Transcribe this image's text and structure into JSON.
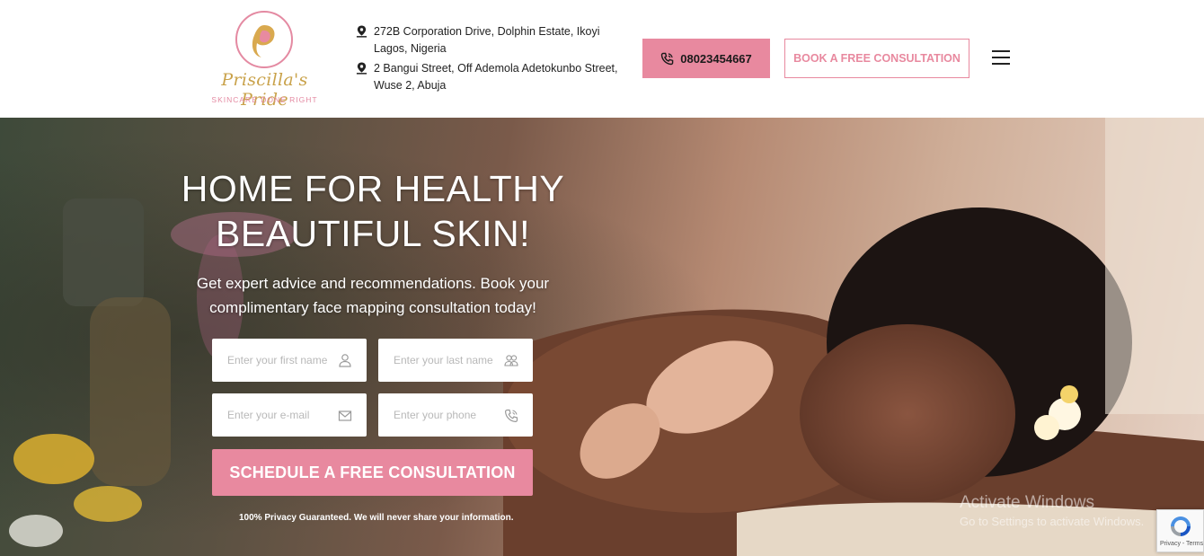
{
  "header": {
    "logo": {
      "name": "Priscilla's Pride",
      "tagline": "SKINCARE DONE RIGHT"
    },
    "addresses": [
      "272B Corporation Drive, Dolphin Estate, Ikoyi Lagos, Nigeria",
      "2 Bangui Street, Off Ademola Adetokunbo Street, Wuse 2, Abuja"
    ],
    "phone_label": "08023454667",
    "consult_label": "BOOK A FREE CONSULTATION"
  },
  "hero": {
    "title_line1": "HOME FOR HEALTHY",
    "title_line2": "BEAUTIFUL SKIN!",
    "subtitle_line1": "Get expert advice and recommendations. Book your",
    "subtitle_line2": "complimentary face mapping consultation today!"
  },
  "form": {
    "first_name_placeholder": "Enter your first name",
    "last_name_placeholder": "Enter your last name",
    "email_placeholder": "Enter your e-mail",
    "phone_placeholder": "Enter your phone",
    "submit_label": "SCHEDULE A FREE CONSULTATION",
    "privacy_text": "100% Privacy Guaranteed. We will never share your information."
  },
  "overlay": {
    "activate_title": "Activate Windows",
    "activate_sub": "Go to Settings to activate Windows.",
    "recaptcha_text": "Privacy - Terms"
  },
  "colors": {
    "accent": "#e8899f",
    "gold": "#c9a24a"
  },
  "icons": [
    "location-pin-icon",
    "phone-icon",
    "hamburger-menu-icon",
    "user-icon",
    "users-icon",
    "envelope-icon",
    "recaptcha-icon"
  ]
}
